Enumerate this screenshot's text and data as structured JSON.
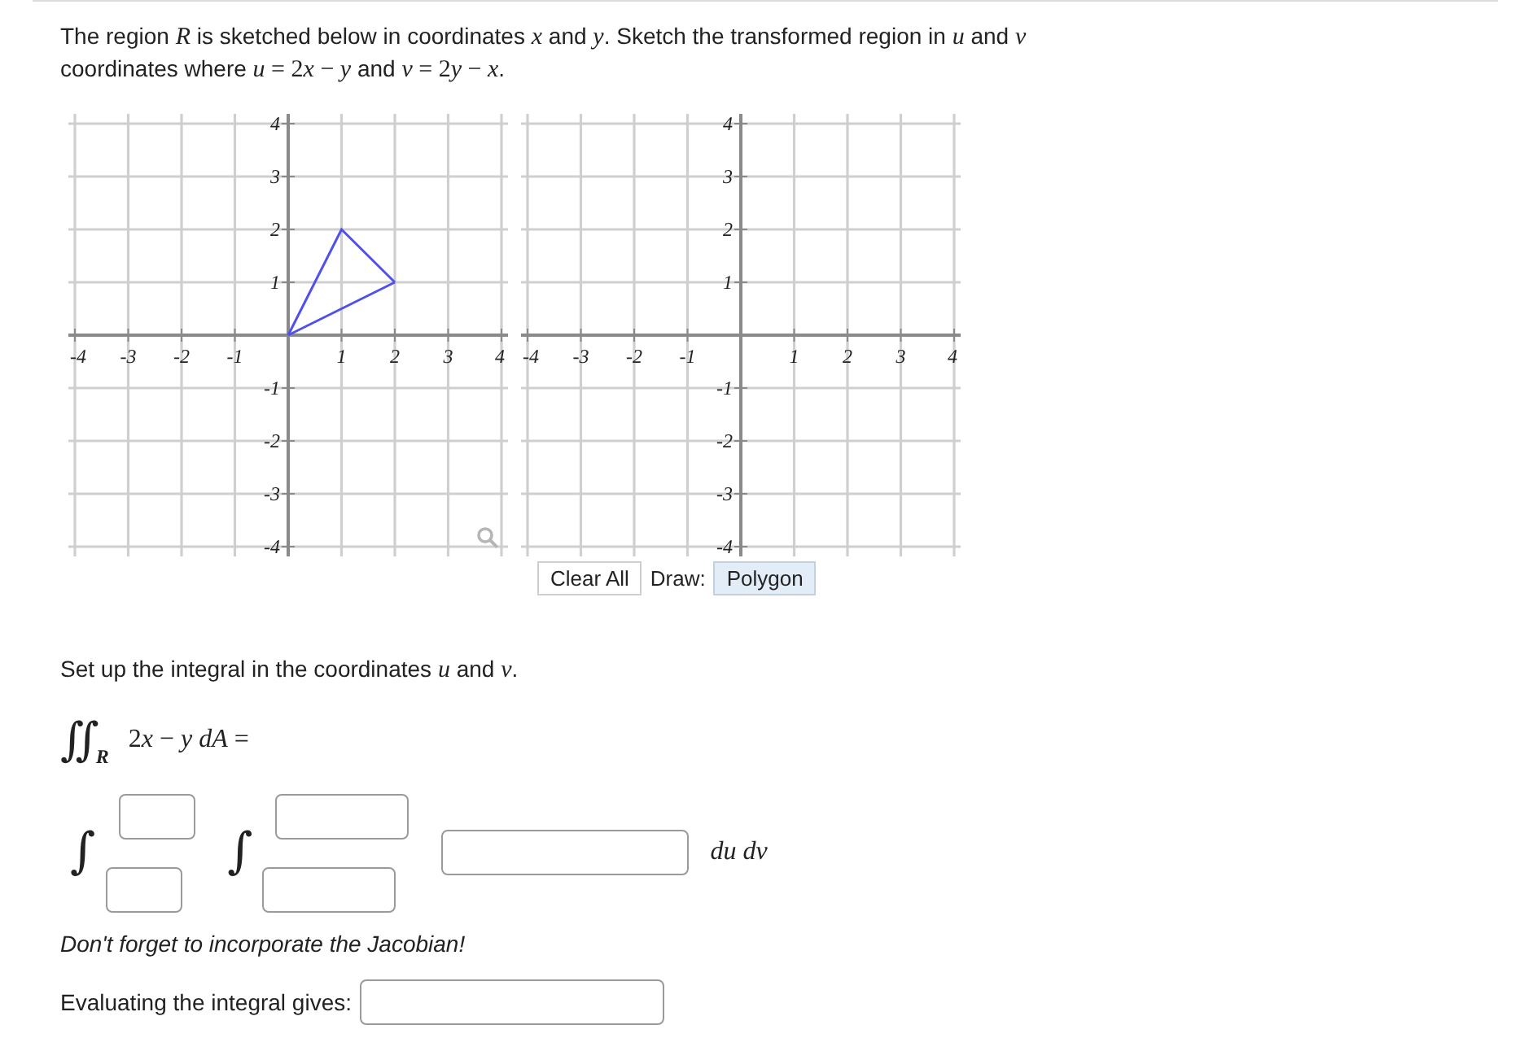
{
  "problem": {
    "segments": [
      {
        "kind": "text",
        "text": "The region "
      },
      {
        "kind": "var",
        "text": "R"
      },
      {
        "kind": "text",
        "text": " is sketched below in coordinates "
      },
      {
        "kind": "var",
        "text": "x"
      },
      {
        "kind": "text",
        "text": " and "
      },
      {
        "kind": "var",
        "text": "y"
      },
      {
        "kind": "text",
        "text": ". Sketch the transformed region in "
      },
      {
        "kind": "var",
        "text": "u"
      },
      {
        "kind": "text",
        "text": " and "
      },
      {
        "kind": "var",
        "text": "v"
      },
      {
        "kind": "text",
        "text": " coordinates where "
      },
      {
        "kind": "var",
        "text": "u"
      },
      {
        "kind": "sym",
        "text": " = 2"
      },
      {
        "kind": "var",
        "text": "x"
      },
      {
        "kind": "sym",
        "text": " − "
      },
      {
        "kind": "var",
        "text": "y"
      },
      {
        "kind": "text",
        "text": " and "
      },
      {
        "kind": "var",
        "text": "v"
      },
      {
        "kind": "sym",
        "text": " = 2"
      },
      {
        "kind": "var",
        "text": "y"
      },
      {
        "kind": "sym",
        "text": " − "
      },
      {
        "kind": "var",
        "text": "x"
      },
      {
        "kind": "text",
        "text": "."
      }
    ]
  },
  "graphs": [
    {
      "magnifier": true,
      "chart_data": {
        "type": "line",
        "x": [
          0,
          1,
          2
        ],
        "series": [
          {
            "color": "#5050ee",
            "values": [
              0,
              2,
              1
            ]
          },
          {
            "color": "#5050ee",
            "values": [
              0,
              0.5,
              1
            ]
          }
        ],
        "xlim": [
          -4,
          4
        ],
        "ylim": [
          -4,
          4
        ],
        "xticks": [
          -4,
          -3,
          -2,
          -1,
          1,
          2,
          3,
          4
        ],
        "yticks": [
          -4,
          -3,
          -2,
          -1,
          1,
          2,
          3,
          4
        ],
        "grid": true
      }
    },
    {
      "chart_data": {
        "type": "line",
        "xlim": [
          -4,
          4
        ],
        "ylim": [
          -4,
          4
        ],
        "xticks": [
          -4,
          -3,
          -2,
          -1,
          1,
          2,
          3,
          4
        ],
        "yticks": [
          -4,
          -3,
          -2,
          -1,
          1,
          2,
          3,
          4
        ],
        "grid": true
      },
      "toolbar": {
        "clear_button": "Clear All",
        "draw_label": "Draw:",
        "draw_modes": [
          {
            "label": "Polygon",
            "selected": true
          }
        ]
      }
    }
  ],
  "setup_prompt": {
    "segments": [
      {
        "kind": "text",
        "text": "Set up the integral in the coordinates "
      },
      {
        "kind": "var",
        "text": "u"
      },
      {
        "kind": "text",
        "text": " and "
      },
      {
        "kind": "var",
        "text": "v"
      },
      {
        "kind": "text",
        "text": "."
      }
    ]
  },
  "double_integral": {
    "sign": "∬",
    "region": "R",
    "integrand": {
      "segments": [
        {
          "kind": "sym",
          "text": "2"
        },
        {
          "kind": "var",
          "text": "x"
        },
        {
          "kind": "sym",
          "text": " − "
        },
        {
          "kind": "var",
          "text": "y dA"
        },
        {
          "kind": "sym",
          "text": " ="
        }
      ]
    }
  },
  "iterated_integral": [
    {
      "kind": "integral",
      "sign": "∫"
    },
    {
      "kind": "integral",
      "sign": "∫"
    },
    {
      "kind": "integrand_field"
    },
    {
      "kind": "differential",
      "text": "du dv"
    }
  ],
  "note": "Don't forget to incorporate the Jacobian!",
  "result": {
    "label": "Evaluating the integral gives:"
  }
}
